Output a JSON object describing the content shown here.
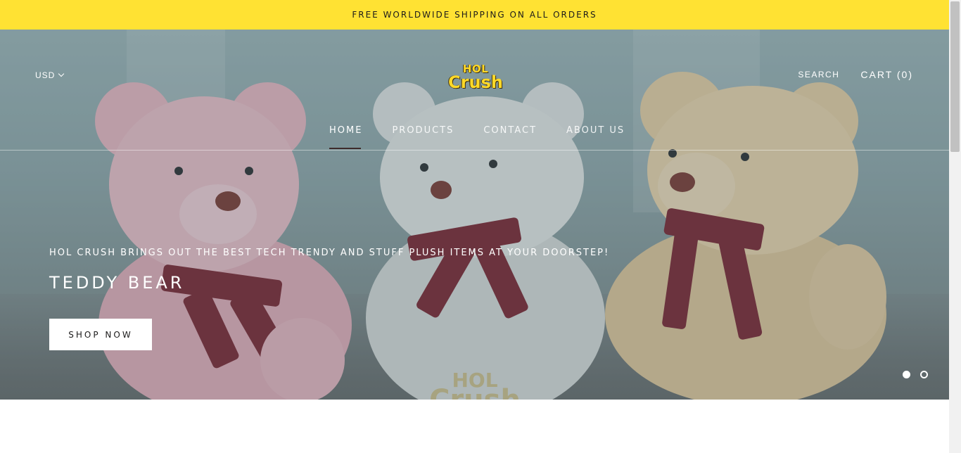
{
  "announcement": {
    "text": "FREE WORLDWIDE SHIPPING ON ALL ORDERS"
  },
  "header": {
    "currency": "USD",
    "logo_line1": "HOL",
    "logo_line2": "Crush",
    "search_label": "SEARCH",
    "cart_label": "CART (0)"
  },
  "nav": {
    "items": [
      {
        "label": "HOME",
        "active": true
      },
      {
        "label": "PRODUCTS",
        "active": false
      },
      {
        "label": "CONTACT",
        "active": false
      },
      {
        "label": "ABOUT US",
        "active": false
      }
    ]
  },
  "hero": {
    "subheading": "HOL CRUSH BRINGS OUT THE BEST TECH TRENDY AND STUFF PLUSH ITEMS AT YOUR DOORSTEP!",
    "title": "TEDDY BEAR",
    "button_label": "SHOP NOW",
    "watermark_line1": "HOL",
    "watermark_line2": "Crush",
    "slides": 2,
    "active_slide": 1
  },
  "colors": {
    "announcement_bg": "#ffe233",
    "logo_yellow": "#ffd928",
    "button_bg": "#ffffff",
    "text_dark": "#1c1b1b"
  }
}
